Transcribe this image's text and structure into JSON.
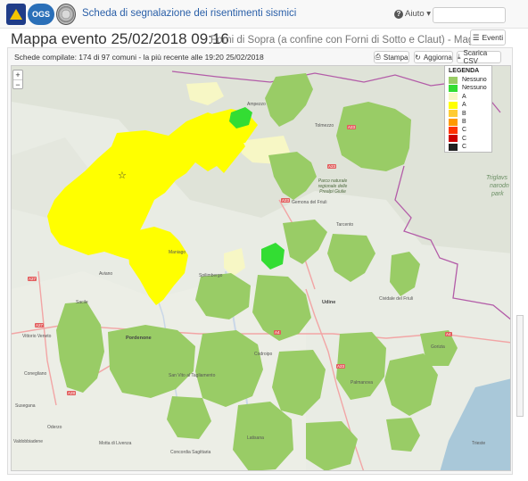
{
  "header": {
    "brand": "Scheda di segnalazione dei risentimenti sismici",
    "help_label": "Aiuto",
    "logos": [
      "protezione-civile-logo",
      "ogs-logo",
      "seal-logo"
    ],
    "logo_ogs_text": "OGS"
  },
  "page": {
    "title": "Mappa evento 25/02/2018 09:16",
    "subtitle": "Forni di Sopra (a confine con Forni di Sotto e Claut) - Magnitudo:",
    "eventi_button": "Eventi",
    "stats": "Schede compilate: 174 di 97 comuni - la più recente alle 19:20 25/02/2018",
    "stampa_button": "Stampa",
    "aggiorna_button": "Aggiorna",
    "csv_button": "Scarica CSV"
  },
  "map": {
    "zoom_in": "+",
    "zoom_out": "−",
    "epicenter": "☆",
    "labels": [
      "Triglavs",
      "narodn",
      "park",
      "Parco naturale regionale delle Prealpi Giulie",
      "Tarcento",
      "Gemona del Friuli",
      "Udine",
      "Pordenone",
      "Vittorio Veneto",
      "Conegliano",
      "Cividale del Friuli",
      "Palmanova",
      "Susegana",
      "Codroipo",
      "San Vito al Tagliamento",
      "Spilimbergo",
      "Maniago",
      "Aviano",
      "Tolmezzo",
      "Ampezzo",
      "Latisana",
      "Concordia Sagittaria",
      "Gorizia",
      "Trieste",
      "Motta di Livenza",
      "Oderzo",
      "Sacile",
      "Valdobbiadene"
    ],
    "roads": [
      "A23",
      "A23",
      "A23",
      "A27",
      "A27",
      "A28",
      "A4",
      "A4",
      "A23"
    ],
    "colors": {
      "intensity_light": "#99cc66",
      "intensity_strong": "#33cc33",
      "intensity_a": "#ffff00",
      "intensity_a_pale": "#f7f7c5",
      "base": "#e9ece4",
      "water": "#a9c8d9",
      "border": "#b35ca8"
    }
  },
  "legend": {
    "title": "LEGENDA",
    "items": [
      {
        "label": "Nessuno",
        "color": "#99cc66"
      },
      {
        "label": "Nessuno",
        "color": "#33dd33"
      },
      {
        "label": "A",
        "color": "#f7f7c5"
      },
      {
        "label": "A",
        "color": "#ffff00"
      },
      {
        "label": "B",
        "color": "#ffcc33"
      },
      {
        "label": "B",
        "color": "#ff9900"
      },
      {
        "label": "C",
        "color": "#ff3300"
      },
      {
        "label": "C",
        "color": "#cc0000"
      },
      {
        "label": "C",
        "color": "#222222"
      }
    ]
  }
}
